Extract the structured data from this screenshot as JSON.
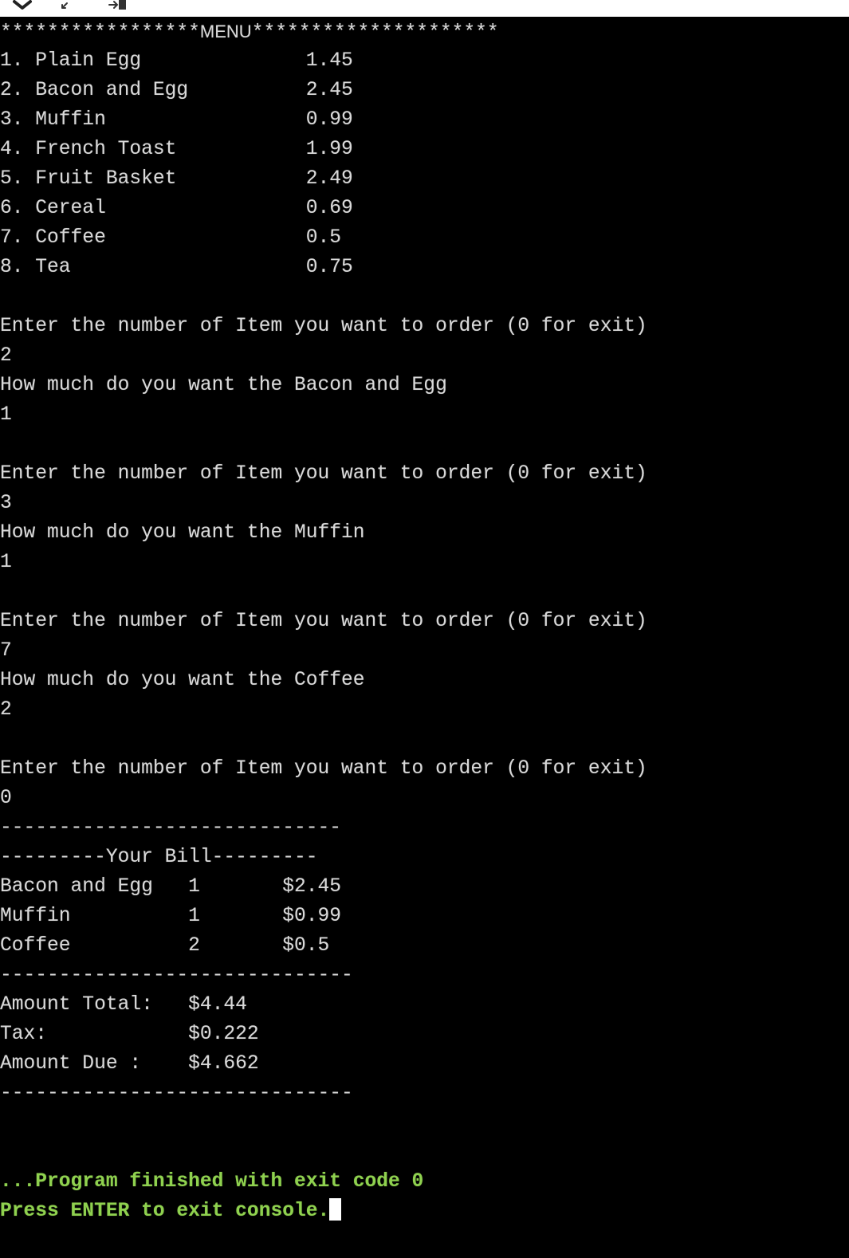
{
  "toolbar": {
    "icons": [
      "chevron-down-icon",
      "minimize-arrow-icon",
      "export-arrow-icon"
    ]
  },
  "menu": {
    "header_stars_left": "*****************",
    "header_label": "MENU",
    "header_stars_right": "*********************",
    "items": [
      {
        "line": "1. Plain Egg              1.45"
      },
      {
        "line": "2. Bacon and Egg          2.45"
      },
      {
        "line": "3. Muffin                 0.99"
      },
      {
        "line": "4. French Toast           1.99"
      },
      {
        "line": "5. Fruit Basket           2.49"
      },
      {
        "line": "6. Cereal                 0.69"
      },
      {
        "line": "7. Coffee                 0.5"
      },
      {
        "line": "8. Tea                    0.75"
      }
    ]
  },
  "session": {
    "lines": [
      "",
      "Enter the number of Item you want to order (0 for exit)",
      "2",
      "How much do you want the Bacon and Egg",
      "1",
      "",
      "Enter the number of Item you want to order (0 for exit)",
      "3",
      "How much do you want the Muffin",
      "1",
      "",
      "Enter the number of Item you want to order (0 for exit)",
      "7",
      "How much do you want the Coffee",
      "2",
      "",
      "Enter the number of Item you want to order (0 for exit)",
      "0"
    ]
  },
  "bill": {
    "divider_top": "-----------------------------",
    "title_line": "---------Your Bill---------",
    "rows": [
      "Bacon and Egg   1       $2.45",
      "Muffin          1       $0.99",
      "Coffee          2       $0.5"
    ],
    "divider_mid": "------------------------------",
    "totals": [
      "Amount Total:   $4.44",
      "Tax:            $0.222",
      "Amount Due :    $4.662"
    ],
    "divider_bottom": "------------------------------"
  },
  "footer": {
    "finished": "...Program finished with exit code 0",
    "press_enter": "Press ENTER to exit console."
  },
  "colors": {
    "background": "#000000",
    "text": "#d9d9d9",
    "finish_text": "#8fd14f",
    "cursor": "#ffffff"
  }
}
